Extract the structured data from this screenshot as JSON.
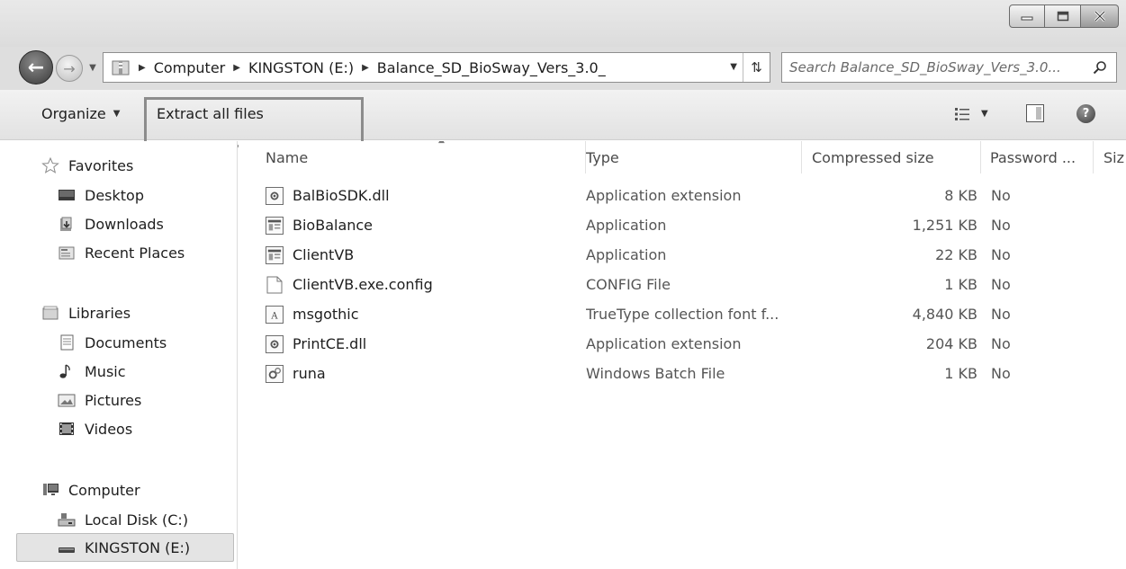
{
  "address": {
    "crumbs": [
      "Computer",
      "KINGSTON (E:)",
      "Balance_SD_BioSway_Vers_3.0_"
    ]
  },
  "search": {
    "placeholder": "Search Balance_SD_BioSway_Vers_3.0..."
  },
  "toolbar": {
    "organize_label": "Organize",
    "extract_label": "Extract all files"
  },
  "nav": {
    "favorites": {
      "label": "Favorites",
      "items": [
        "Desktop",
        "Downloads",
        "Recent Places"
      ]
    },
    "libraries": {
      "label": "Libraries",
      "items": [
        "Documents",
        "Music",
        "Pictures",
        "Videos"
      ]
    },
    "computer": {
      "label": "Computer",
      "items": [
        "Local Disk (C:)",
        "KINGSTON (E:)"
      ]
    },
    "selected": "KINGSTON (E:)"
  },
  "columns": [
    "Name",
    "Type",
    "Compressed size",
    "Password ...",
    "Siz"
  ],
  "files": [
    {
      "name": "BalBioSDK.dll",
      "type": "Application extension",
      "compressed": "8 KB",
      "password": "No",
      "icon": "dll-file-icon"
    },
    {
      "name": "BioBalance",
      "type": "Application",
      "compressed": "1,251 KB",
      "password": "No",
      "icon": "application-icon"
    },
    {
      "name": "ClientVB",
      "type": "Application",
      "compressed": "22 KB",
      "password": "No",
      "icon": "application-icon"
    },
    {
      "name": "ClientVB.exe.config",
      "type": "CONFIG File",
      "compressed": "1 KB",
      "password": "No",
      "icon": "blank-file-icon"
    },
    {
      "name": "msgothic",
      "type": "TrueType collection font f...",
      "compressed": "4,840 KB",
      "password": "No",
      "icon": "font-file-icon"
    },
    {
      "name": "PrintCE.dll",
      "type": "Application extension",
      "compressed": "204 KB",
      "password": "No",
      "icon": "dll-file-icon"
    },
    {
      "name": "runa",
      "type": "Windows Batch File",
      "compressed": "1 KB",
      "password": "No",
      "icon": "batch-file-icon"
    }
  ]
}
